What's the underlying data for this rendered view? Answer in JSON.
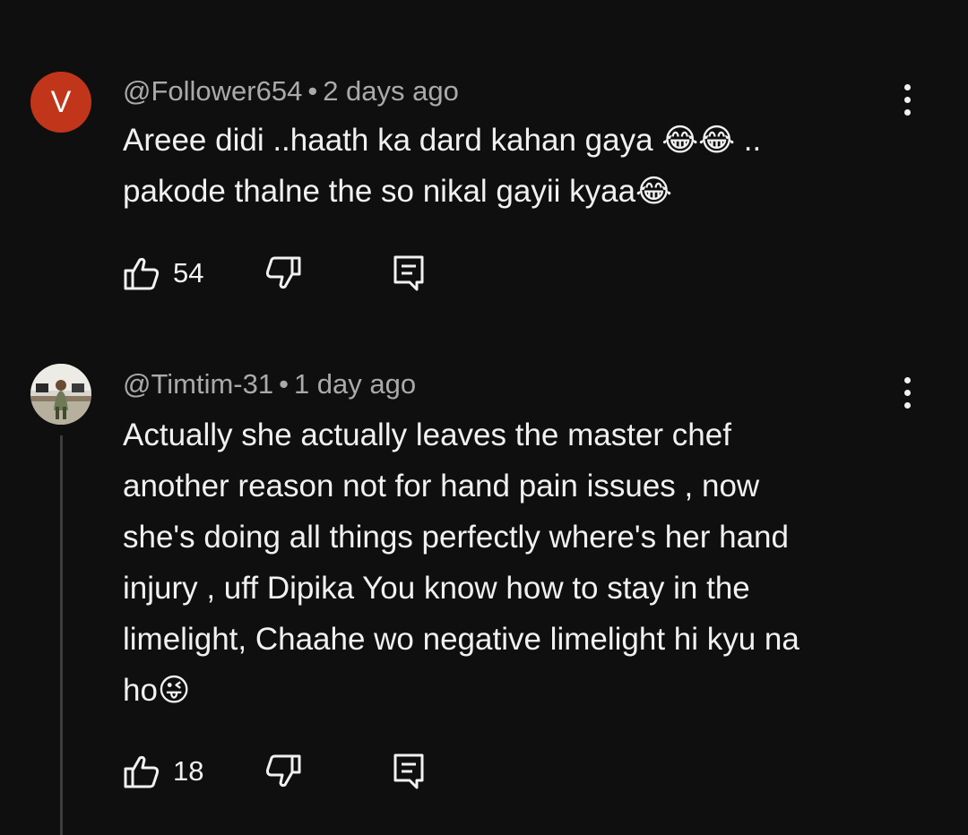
{
  "comments": [
    {
      "avatar_letter": "V",
      "avatar_color": "#c1351a",
      "author": "@Follower654",
      "separator": "•",
      "time": "2 days ago",
      "lines": [
        "Areee didi ..haath ka dard kahan gaya 😂😂 ..",
        "pakode thalne the so nikal gayii kyaa😂"
      ],
      "likes": "54",
      "icons": {
        "like": "thumbs-up-icon",
        "dislike": "thumbs-down-icon",
        "reply": "reply-comment-icon",
        "more": "more-vertical-icon"
      }
    },
    {
      "avatar_desc": "photo-avatar",
      "author": "@Timtim-31",
      "separator": "•",
      "time": "1 day ago",
      "lines": [
        "Actually she actually leaves the master chef",
        "another reason not for hand pain issues , now",
        "she's doing all things perfectly where's her hand",
        "injury , uff Dipika You know how to stay in the",
        "limelight, Chaahe wo negative limelight hi kyu na",
        "ho😜"
      ],
      "likes": "18",
      "icons": {
        "like": "thumbs-up-icon",
        "dislike": "thumbs-down-icon",
        "reply": "reply-comment-icon",
        "more": "more-vertical-icon"
      }
    }
  ],
  "theme": {
    "background": "#0f0f0f",
    "text": "#f1f1f1",
    "meta_text": "#aaaaaa"
  }
}
